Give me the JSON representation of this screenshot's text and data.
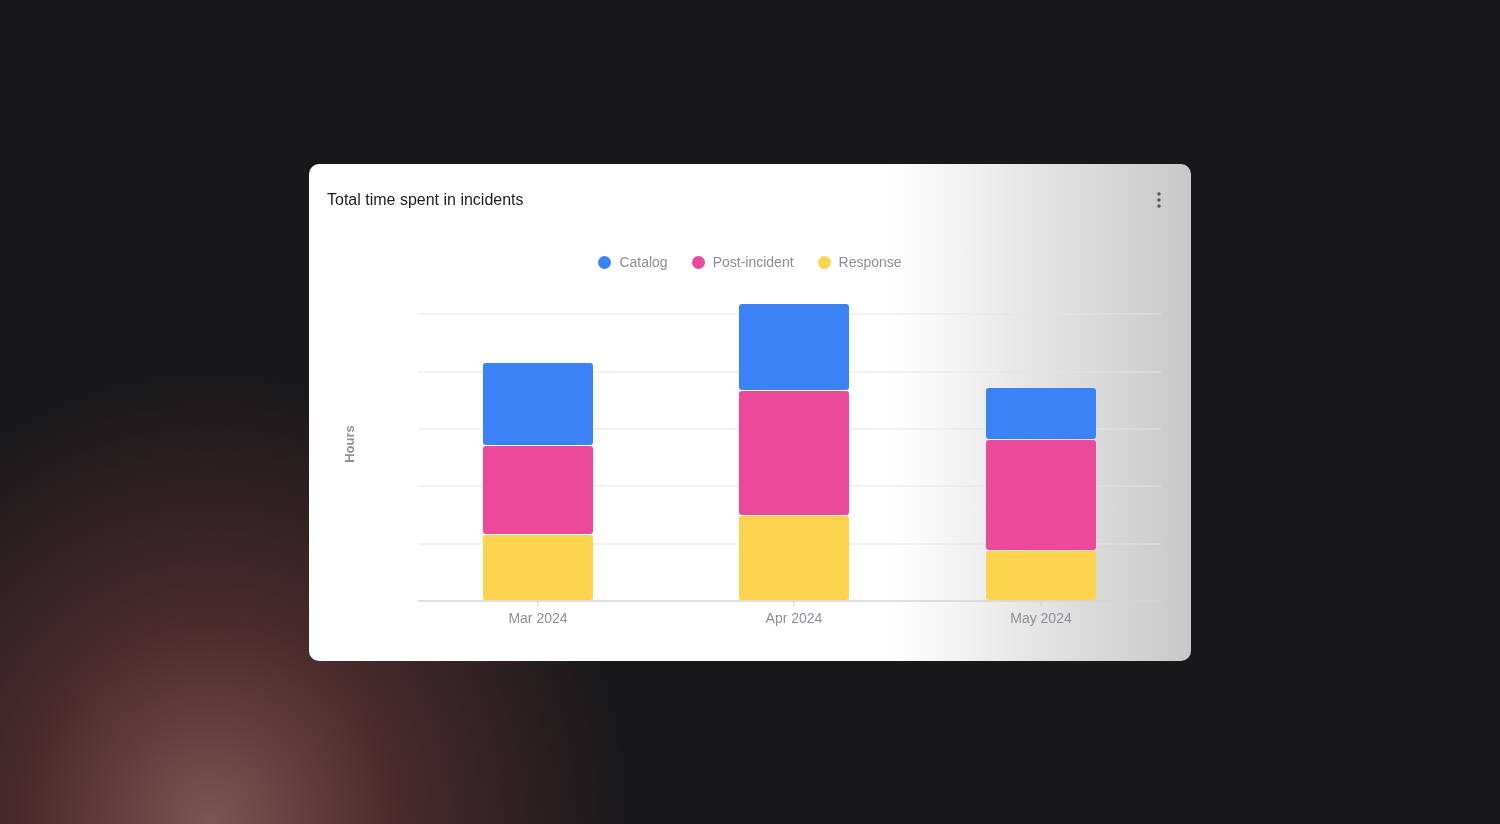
{
  "card": {
    "title": "Total time spent in incidents",
    "legend": [
      {
        "label": "Catalog",
        "color": "#3b82f6"
      },
      {
        "label": "Post-incident",
        "color": "#ec4899"
      },
      {
        "label": "Response",
        "color": "#fcd34d"
      }
    ],
    "y_axis_label": "Hours",
    "x_labels": [
      "Mar 2024",
      "Apr 2024",
      "May 2024"
    ]
  }
}
